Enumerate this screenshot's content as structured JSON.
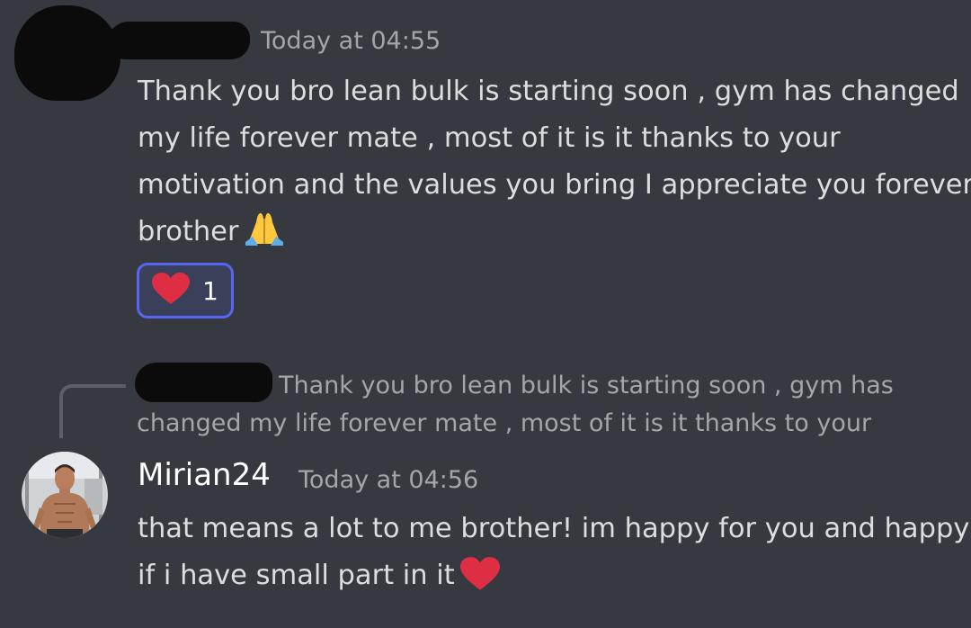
{
  "message1": {
    "timestamp": "Today at 04:55",
    "lines": [
      "Thank you bro lean bulk is starting soon , gym has changed",
      "my life forever mate , most of it is it thanks to your",
      "motivation and the values you bring I appreciate you forever",
      "brother"
    ],
    "emoji": "pray-emoji",
    "reaction": {
      "emoji": "heart-emoji",
      "count": "1"
    }
  },
  "reply": {
    "preview_line1": "Thank you bro lean bulk is starting soon , gym has",
    "preview_line2": "changed my life forever mate , most of it is it thanks to your"
  },
  "message2": {
    "author": "Mirian24",
    "timestamp": "Today at 04:56",
    "lines": [
      "that means a lot to me brother! im happy for you and happy",
      "if i have small part in it"
    ],
    "emoji": "heart-emoji"
  },
  "colors": {
    "background": "#36393f",
    "text": "#dcddde",
    "muted": "#a3a6aa",
    "reaction_bg": "#3b405a",
    "reaction_border": "#5865f2",
    "heart": "#dd2e44"
  }
}
